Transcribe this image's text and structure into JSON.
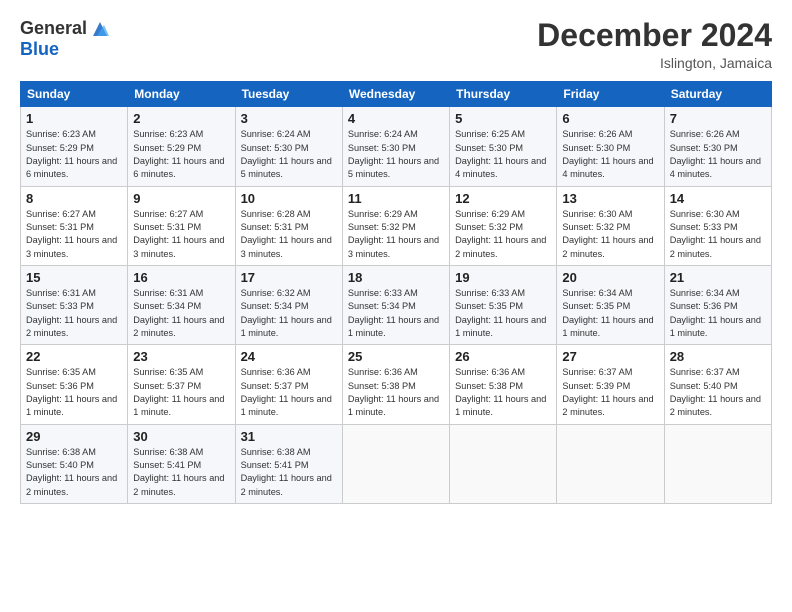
{
  "header": {
    "logo_general": "General",
    "logo_blue": "Blue",
    "month_title": "December 2024",
    "location": "Islington, Jamaica"
  },
  "weekdays": [
    "Sunday",
    "Monday",
    "Tuesday",
    "Wednesday",
    "Thursday",
    "Friday",
    "Saturday"
  ],
  "weeks": [
    [
      {
        "day": "1",
        "sunrise": "6:23 AM",
        "sunset": "5:29 PM",
        "daylight": "11 hours and 6 minutes."
      },
      {
        "day": "2",
        "sunrise": "6:23 AM",
        "sunset": "5:29 PM",
        "daylight": "11 hours and 6 minutes."
      },
      {
        "day": "3",
        "sunrise": "6:24 AM",
        "sunset": "5:30 PM",
        "daylight": "11 hours and 5 minutes."
      },
      {
        "day": "4",
        "sunrise": "6:24 AM",
        "sunset": "5:30 PM",
        "daylight": "11 hours and 5 minutes."
      },
      {
        "day": "5",
        "sunrise": "6:25 AM",
        "sunset": "5:30 PM",
        "daylight": "11 hours and 4 minutes."
      },
      {
        "day": "6",
        "sunrise": "6:26 AM",
        "sunset": "5:30 PM",
        "daylight": "11 hours and 4 minutes."
      },
      {
        "day": "7",
        "sunrise": "6:26 AM",
        "sunset": "5:30 PM",
        "daylight": "11 hours and 4 minutes."
      }
    ],
    [
      {
        "day": "8",
        "sunrise": "6:27 AM",
        "sunset": "5:31 PM",
        "daylight": "11 hours and 3 minutes."
      },
      {
        "day": "9",
        "sunrise": "6:27 AM",
        "sunset": "5:31 PM",
        "daylight": "11 hours and 3 minutes."
      },
      {
        "day": "10",
        "sunrise": "6:28 AM",
        "sunset": "5:31 PM",
        "daylight": "11 hours and 3 minutes."
      },
      {
        "day": "11",
        "sunrise": "6:29 AM",
        "sunset": "5:32 PM",
        "daylight": "11 hours and 3 minutes."
      },
      {
        "day": "12",
        "sunrise": "6:29 AM",
        "sunset": "5:32 PM",
        "daylight": "11 hours and 2 minutes."
      },
      {
        "day": "13",
        "sunrise": "6:30 AM",
        "sunset": "5:32 PM",
        "daylight": "11 hours and 2 minutes."
      },
      {
        "day": "14",
        "sunrise": "6:30 AM",
        "sunset": "5:33 PM",
        "daylight": "11 hours and 2 minutes."
      }
    ],
    [
      {
        "day": "15",
        "sunrise": "6:31 AM",
        "sunset": "5:33 PM",
        "daylight": "11 hours and 2 minutes."
      },
      {
        "day": "16",
        "sunrise": "6:31 AM",
        "sunset": "5:34 PM",
        "daylight": "11 hours and 2 minutes."
      },
      {
        "day": "17",
        "sunrise": "6:32 AM",
        "sunset": "5:34 PM",
        "daylight": "11 hours and 1 minute."
      },
      {
        "day": "18",
        "sunrise": "6:33 AM",
        "sunset": "5:34 PM",
        "daylight": "11 hours and 1 minute."
      },
      {
        "day": "19",
        "sunrise": "6:33 AM",
        "sunset": "5:35 PM",
        "daylight": "11 hours and 1 minute."
      },
      {
        "day": "20",
        "sunrise": "6:34 AM",
        "sunset": "5:35 PM",
        "daylight": "11 hours and 1 minute."
      },
      {
        "day": "21",
        "sunrise": "6:34 AM",
        "sunset": "5:36 PM",
        "daylight": "11 hours and 1 minute."
      }
    ],
    [
      {
        "day": "22",
        "sunrise": "6:35 AM",
        "sunset": "5:36 PM",
        "daylight": "11 hours and 1 minute."
      },
      {
        "day": "23",
        "sunrise": "6:35 AM",
        "sunset": "5:37 PM",
        "daylight": "11 hours and 1 minute."
      },
      {
        "day": "24",
        "sunrise": "6:36 AM",
        "sunset": "5:37 PM",
        "daylight": "11 hours and 1 minute."
      },
      {
        "day": "25",
        "sunrise": "6:36 AM",
        "sunset": "5:38 PM",
        "daylight": "11 hours and 1 minute."
      },
      {
        "day": "26",
        "sunrise": "6:36 AM",
        "sunset": "5:38 PM",
        "daylight": "11 hours and 1 minute."
      },
      {
        "day": "27",
        "sunrise": "6:37 AM",
        "sunset": "5:39 PM",
        "daylight": "11 hours and 2 minutes."
      },
      {
        "day": "28",
        "sunrise": "6:37 AM",
        "sunset": "5:40 PM",
        "daylight": "11 hours and 2 minutes."
      }
    ],
    [
      {
        "day": "29",
        "sunrise": "6:38 AM",
        "sunset": "5:40 PM",
        "daylight": "11 hours and 2 minutes."
      },
      {
        "day": "30",
        "sunrise": "6:38 AM",
        "sunset": "5:41 PM",
        "daylight": "11 hours and 2 minutes."
      },
      {
        "day": "31",
        "sunrise": "6:38 AM",
        "sunset": "5:41 PM",
        "daylight": "11 hours and 2 minutes."
      },
      null,
      null,
      null,
      null
    ]
  ],
  "labels": {
    "sunrise": "Sunrise:",
    "sunset": "Sunset:",
    "daylight": "Daylight:"
  }
}
